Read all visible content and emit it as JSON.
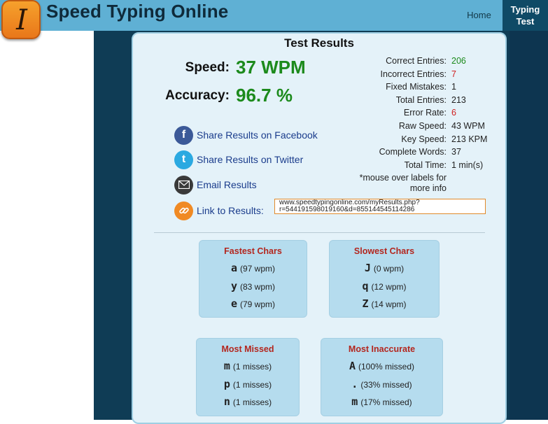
{
  "header": {
    "site_title": "Speed Typing Online",
    "logo_glyph": "I",
    "nav": {
      "home": "Home",
      "typing_test_line1": "Typing",
      "typing_test_line2": "Test"
    }
  },
  "results": {
    "title": "Test Results",
    "speed_label": "Speed:",
    "speed_value": "37 WPM",
    "accuracy_label": "Accuracy:",
    "accuracy_value": "96.7 %",
    "share": {
      "facebook": "Share Results on Facebook",
      "twitter": "Share Results on Twitter",
      "email": "Email Results",
      "link": "Link to Results:"
    },
    "link_value_line1": "www.speedtypingonline.com/myResults.php?",
    "link_value_line2": "r=544191598019160&d=855144545114286",
    "stats": [
      {
        "label": "Correct Entries:",
        "value": "206",
        "color": "#1c8a1c"
      },
      {
        "label": "Incorrect Entries:",
        "value": "7",
        "color": "#d02020"
      },
      {
        "label": "Fixed Mistakes:",
        "value": "1",
        "color": "#222222"
      },
      {
        "label": "Total Entries:",
        "value": "213",
        "color": "#222222"
      },
      {
        "label": "Error Rate:",
        "value": "6",
        "color": "#d02020"
      },
      {
        "label": "Raw Speed:",
        "value": "43 WPM",
        "color": "#222222"
      },
      {
        "label": "Key Speed:",
        "value": "213 KPM",
        "color": "#222222"
      },
      {
        "label": "Complete Words:",
        "value": "37",
        "color": "#222222"
      },
      {
        "label": "Total Time:",
        "value": "1 min(s)",
        "color": "#222222"
      }
    ],
    "note_line1": "*mouse over labels for",
    "note_line2": "more info"
  },
  "cards": {
    "fastest": {
      "title": "Fastest Chars",
      "rows": [
        {
          "char": "a",
          "detail": "(97 wpm)"
        },
        {
          "char": "y",
          "detail": "(83 wpm)"
        },
        {
          "char": "e",
          "detail": "(79 wpm)"
        }
      ]
    },
    "slowest": {
      "title": "Slowest Chars",
      "rows": [
        {
          "char": "J",
          "detail": "(0 wpm)"
        },
        {
          "char": "q",
          "detail": "(12 wpm)"
        },
        {
          "char": "Z",
          "detail": "(14 wpm)"
        }
      ]
    },
    "most_missed": {
      "title": "Most Missed",
      "rows": [
        {
          "char": "m",
          "detail": "(1 misses)"
        },
        {
          "char": "p",
          "detail": "(1 misses)"
        },
        {
          "char": "n",
          "detail": "(1 misses)"
        }
      ]
    },
    "most_inaccurate": {
      "title": "Most Inaccurate",
      "rows": [
        {
          "char": "A",
          "detail": "(100% missed)"
        },
        {
          "char": ".",
          "detail": "(33% missed)"
        },
        {
          "char": "m",
          "detail": "(17% missed)"
        }
      ]
    }
  },
  "icons": {
    "facebook": "facebook-icon",
    "twitter": "twitter-icon",
    "email": "email-icon",
    "link": "link-icon"
  },
  "colors": {
    "header": "#5fb0d4",
    "nav_active": "#0f4a66",
    "good": "#1c8a1c",
    "bad": "#d02020",
    "card_title": "#b3261e"
  }
}
